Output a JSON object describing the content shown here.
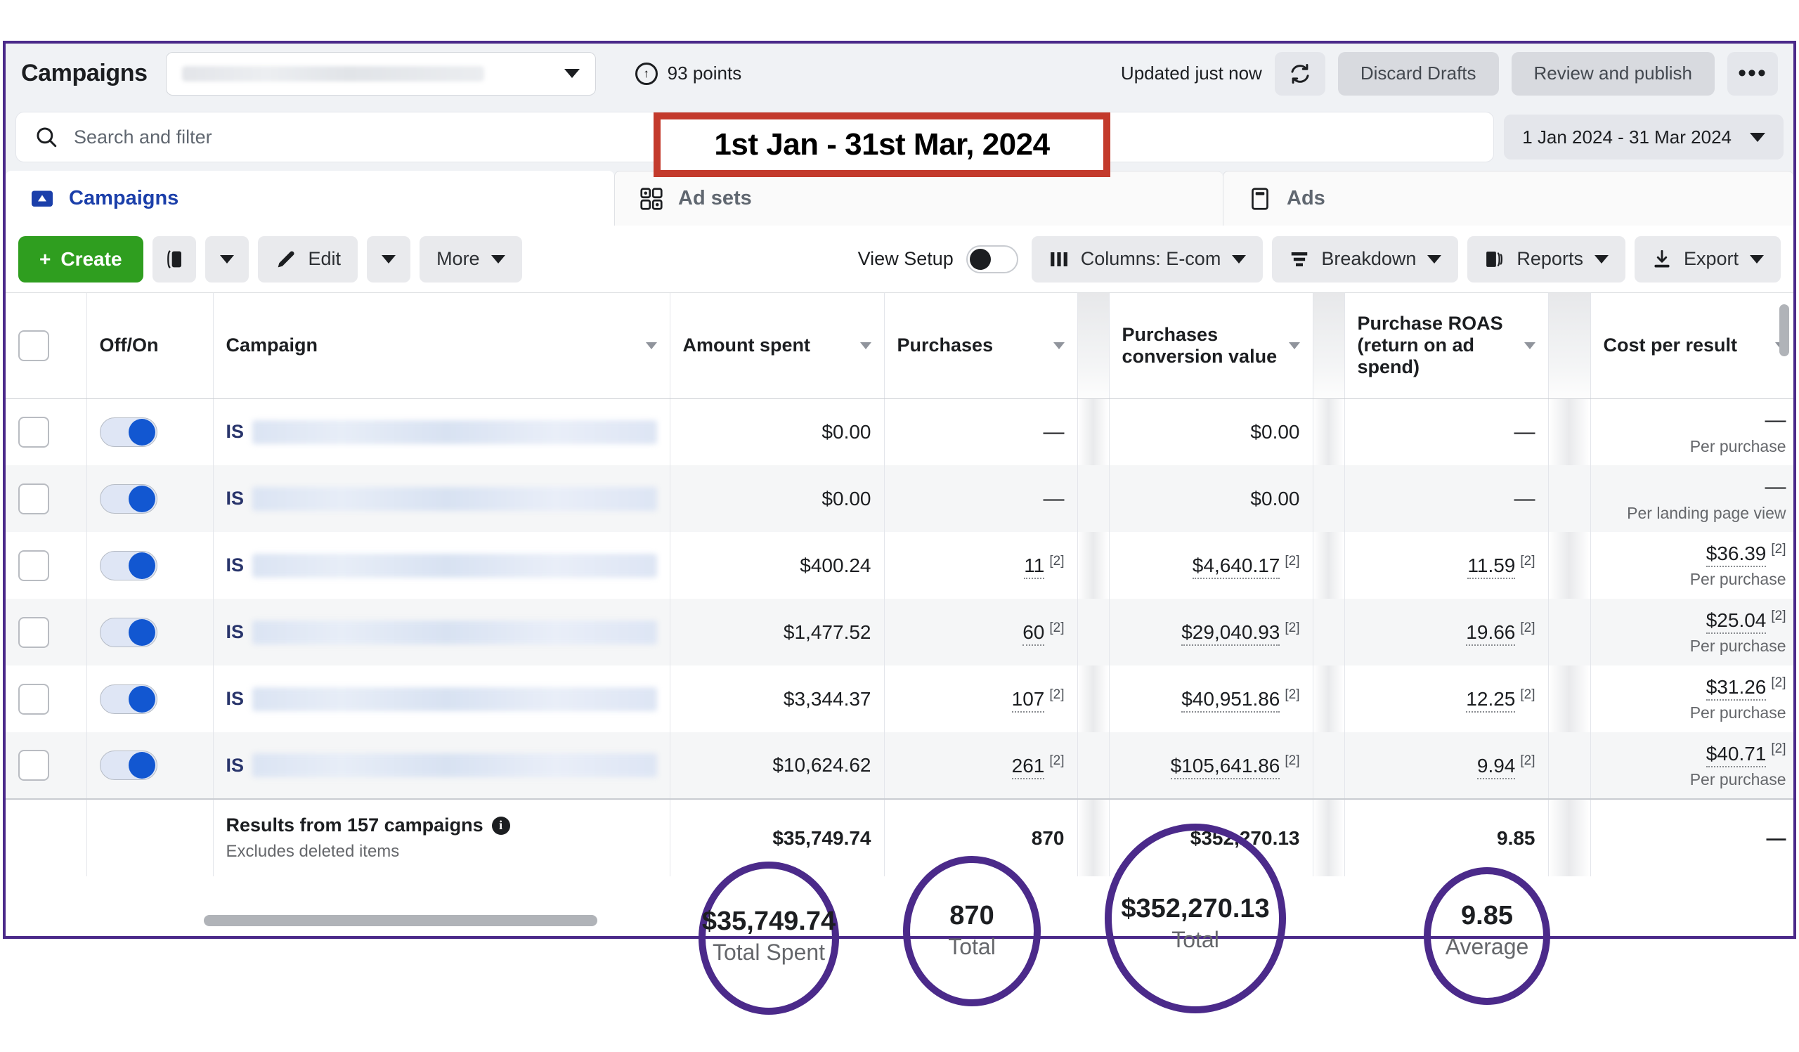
{
  "header": {
    "title": "Campaigns",
    "account_select_value": "",
    "points": "93 points",
    "updated": "Updated just now",
    "refresh_icon": "refresh-icon",
    "discard_drafts": "Discard Drafts",
    "review_publish": "Review and publish",
    "more_menu": "•••"
  },
  "search": {
    "placeholder": "Search and filter",
    "icon": "search-icon",
    "date_range": "1 Jan 2024 - 31 Mar 2024"
  },
  "tabs": [
    {
      "label": "Campaigns",
      "icon": "campaigns-icon",
      "active": true
    },
    {
      "label": "Ad sets",
      "icon": "adsets-grid-icon",
      "active": false
    },
    {
      "label": "Ads",
      "icon": "ads-card-icon",
      "active": false
    }
  ],
  "toolbar": {
    "create": "Create",
    "duplicate_icon": "duplicate-icon",
    "edit": "Edit",
    "edit_icon": "pencil-icon",
    "more": "More",
    "view_setup": "View Setup",
    "view_setup_on": false,
    "columns": "Columns: E-com",
    "columns_icon": "columns-icon",
    "breakdown": "Breakdown",
    "breakdown_icon": "breakdown-icon",
    "reports": "Reports",
    "reports_icon": "reports-icon",
    "export": "Export",
    "export_icon": "download-icon"
  },
  "table": {
    "columns": [
      "Off/On",
      "Campaign",
      "Amount spent",
      "Purchases",
      "Purchases conversion value",
      "Purchase ROAS (return on ad spend)",
      "Cost per result"
    ],
    "rows": [
      {
        "on": true,
        "tag": "IS",
        "amount_spent": "$0.00",
        "purchases": "—",
        "purchases_sup": "",
        "conv_value": "$0.00",
        "conv_sup": "",
        "roas": "—",
        "roas_sup": "",
        "cost_per_result": "—",
        "cpr_sup": "",
        "cpr_sub": "Per purchase"
      },
      {
        "on": true,
        "tag": "IS",
        "amount_spent": "$0.00",
        "purchases": "—",
        "purchases_sup": "",
        "conv_value": "$0.00",
        "conv_sup": "",
        "roas": "—",
        "roas_sup": "",
        "cost_per_result": "—",
        "cpr_sup": "",
        "cpr_sub": "Per landing page view"
      },
      {
        "on": true,
        "tag": "IS",
        "amount_spent": "$400.24",
        "purchases": "11",
        "purchases_sup": "[2]",
        "conv_value": "$4,640.17",
        "conv_sup": "[2]",
        "roas": "11.59",
        "roas_sup": "[2]",
        "cost_per_result": "$36.39",
        "cpr_sup": "[2]",
        "cpr_sub": "Per purchase"
      },
      {
        "on": true,
        "tag": "IS",
        "amount_spent": "$1,477.52",
        "purchases": "60",
        "purchases_sup": "[2]",
        "conv_value": "$29,040.93",
        "conv_sup": "[2]",
        "roas": "19.66",
        "roas_sup": "[2]",
        "cost_per_result": "$25.04",
        "cpr_sup": "[2]",
        "cpr_sub": "Per purchase"
      },
      {
        "on": true,
        "tag": "IS",
        "amount_spent": "$3,344.37",
        "purchases": "107",
        "purchases_sup": "[2]",
        "conv_value": "$40,951.86",
        "conv_sup": "[2]",
        "roas": "12.25",
        "roas_sup": "[2]",
        "cost_per_result": "$31.26",
        "cpr_sup": "[2]",
        "cpr_sub": "Per purchase"
      },
      {
        "on": true,
        "tag": "IS",
        "amount_spent": "$10,624.62",
        "purchases": "261",
        "purchases_sup": "[2]",
        "conv_value": "$105,641.86",
        "conv_sup": "[2]",
        "roas": "9.94",
        "roas_sup": "[2]",
        "cost_per_result": "$40.71",
        "cpr_sup": "[2]",
        "cpr_sub": "Per purchase"
      }
    ],
    "summary": {
      "title": "Results from 157 campaigns",
      "subtitle": "Excludes deleted items",
      "info_icon": "info-icon",
      "amount_spent": "$35,749.74",
      "purchases": "870",
      "conv_value": "$352,270.13",
      "roas": "9.85",
      "cost_per_result": "—"
    }
  },
  "annotations": {
    "date_box": "1st Jan  - 31st Mar, 2024",
    "date_box_color": "#c33a2c",
    "circle_color": "#4b2a8a",
    "callouts": [
      {
        "value": "$35,749.74",
        "label": "Total Spent"
      },
      {
        "value": "870",
        "label": "Total"
      },
      {
        "value": "$352,270.13",
        "label": "Total"
      },
      {
        "value": "9.85",
        "label": "Average"
      }
    ]
  }
}
